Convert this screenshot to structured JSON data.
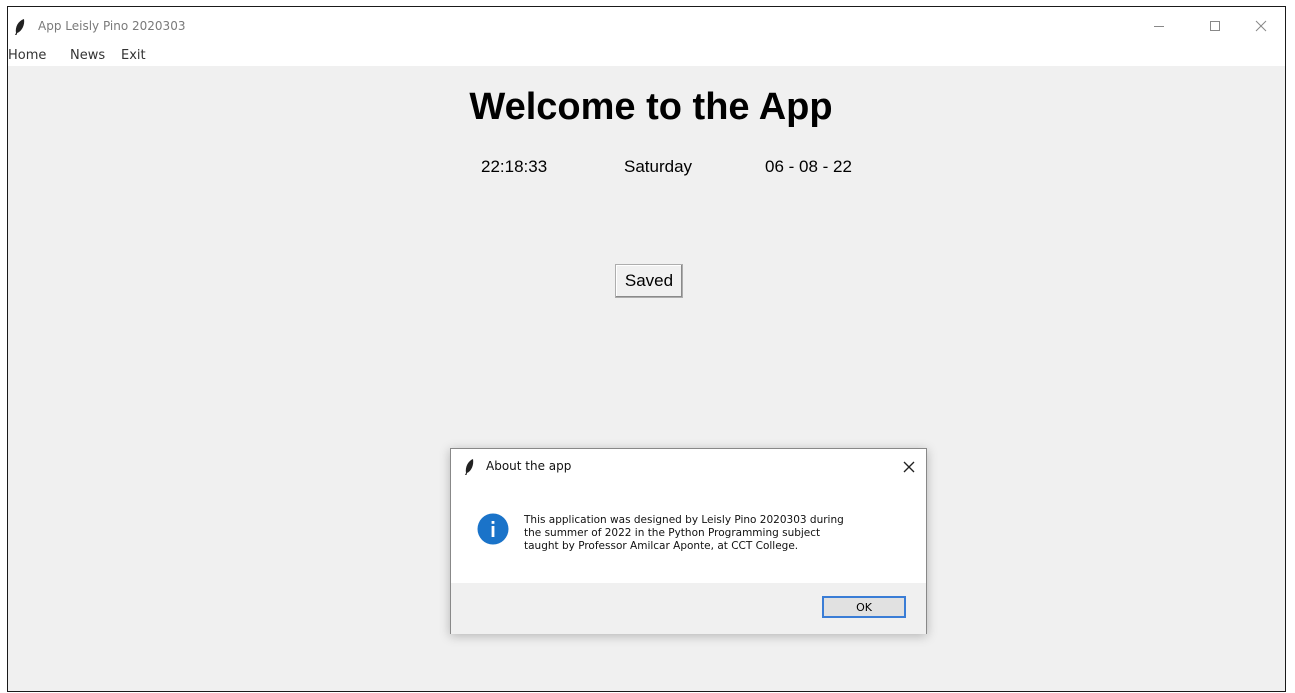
{
  "window": {
    "title": "App Leisly Pino 2020303",
    "controls": {
      "minimize_icon": "minimize-icon",
      "maximize_icon": "maximize-icon",
      "close_icon": "close-icon"
    }
  },
  "menu": {
    "items": [
      {
        "label": "Home"
      },
      {
        "label": "News"
      },
      {
        "label": "Exit"
      }
    ]
  },
  "main": {
    "heading": "Welcome to the App",
    "time": "22:18:33",
    "weekday": "Saturday",
    "date": "06 - 08 - 22",
    "saved_button": "Saved"
  },
  "dialog": {
    "title": "About the app",
    "message_lines": [
      "This application was designed by Leisly Pino 2020303 during",
      "the summer of 2022 in the Python Programming subject",
      "taught by Professor Amilcar Aponte, at CCT College."
    ],
    "ok_label": "OK",
    "icon": "info-icon",
    "accent": "#1a73c9"
  }
}
